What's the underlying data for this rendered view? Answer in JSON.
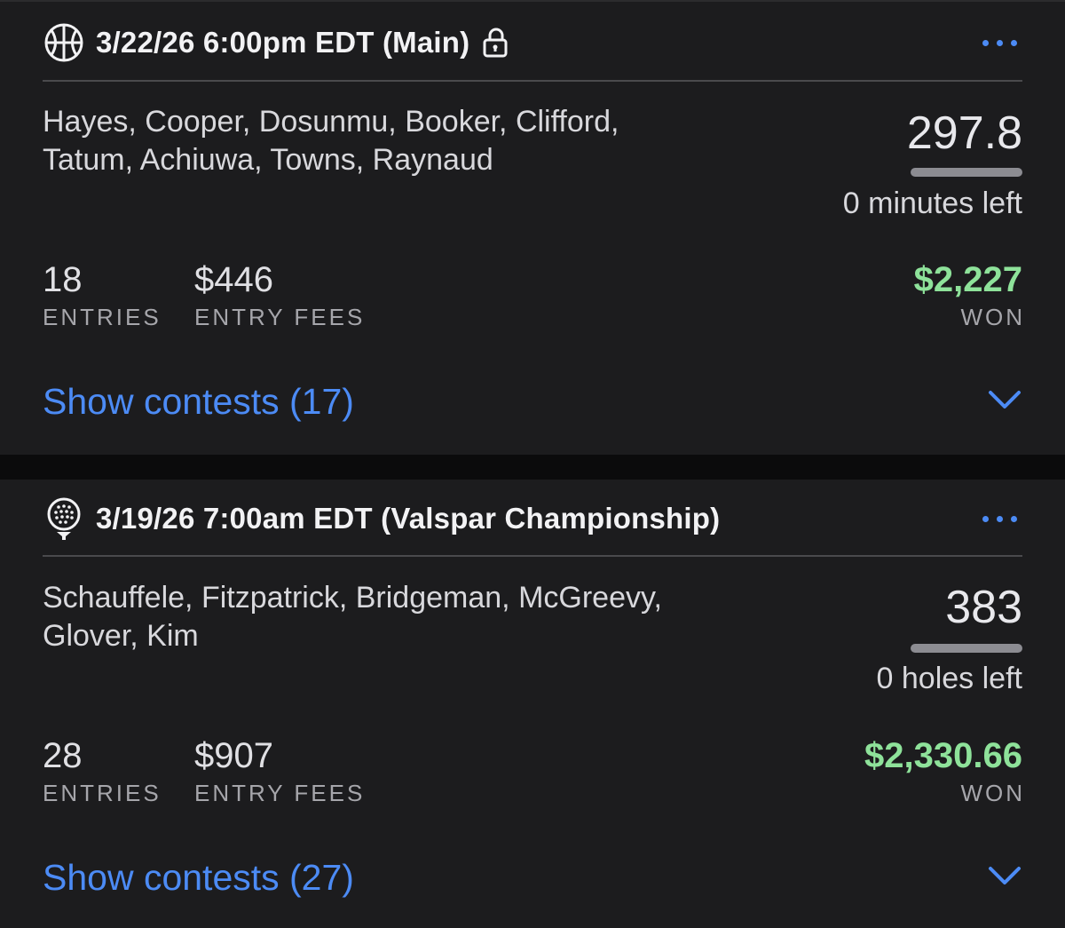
{
  "cards": [
    {
      "sport_icon": "basketball-icon",
      "title": "3/22/26 6:00pm EDT (Main)",
      "lock_icon": "unlocked-padlock-icon",
      "players_line1": "Hayes, Cooper, Dosunmu, Booker, Clifford,",
      "players_line2": "Tatum, Achiuwa, Towns, Raynaud",
      "score": "297.8",
      "time_left": "0 minutes left",
      "entries_value": "18",
      "entries_label": "ENTRIES",
      "fees_value": "$446",
      "fees_label": "ENTRY FEES",
      "won_value": "$2,227",
      "won_label": "WON",
      "show_contests": "Show contests (17)"
    },
    {
      "sport_icon": "golf-ball-icon",
      "title": "3/19/26 7:00am EDT (Valspar Championship)",
      "players_line1": "Schauffele, Fitzpatrick, Bridgeman, McGreevy,",
      "players_line2": "Glover, Kim",
      "score": "383",
      "time_left": "0 holes left",
      "entries_value": "28",
      "entries_label": "ENTRIES",
      "fees_value": "$907",
      "fees_label": "ENTRY FEES",
      "won_value": "$2,330.66",
      "won_label": "WON",
      "show_contests": "Show contests (27)"
    }
  ],
  "colors": {
    "accent": "#4c8bf5",
    "won": "#8ee29a",
    "card_bg": "#1c1c1e",
    "page_bg": "#0b0b0c"
  },
  "icons": {
    "more": "more-horizontal-icon",
    "expand": "chevron-down-icon"
  }
}
